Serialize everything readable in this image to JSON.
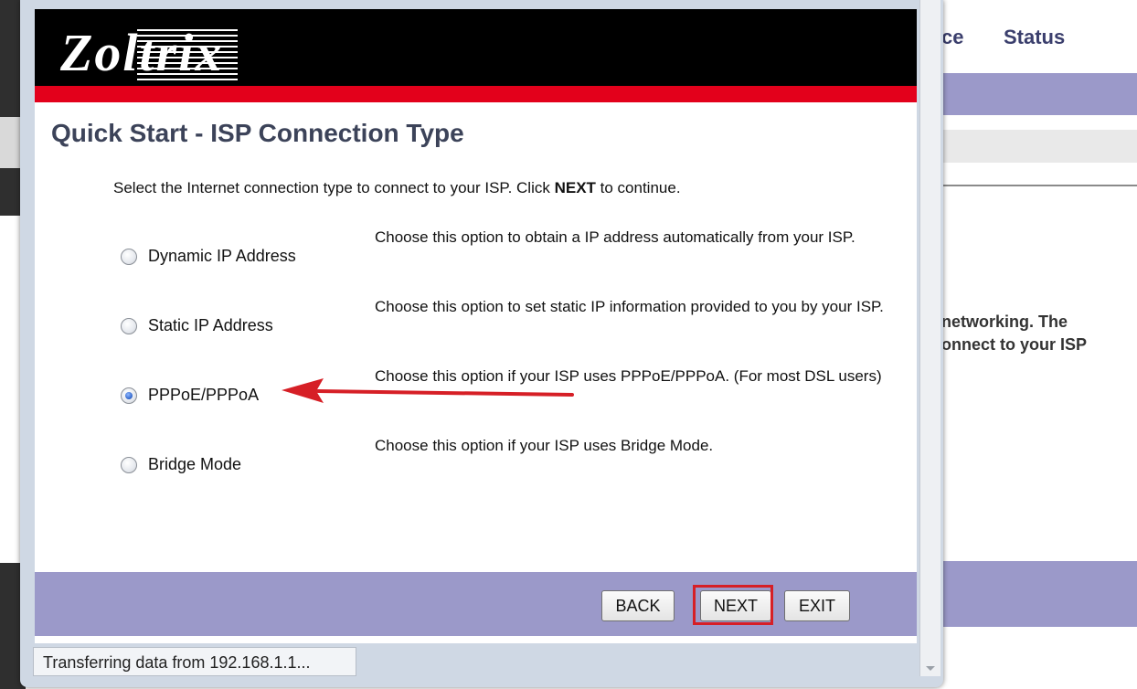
{
  "background": {
    "tab_partial": "ce",
    "tab_status": "Status",
    "body_text": "networking. The\nonnect to your ISP"
  },
  "popup": {
    "logo": "Zoltrix",
    "title": "Quick Start - ISP Connection Type",
    "instruction_prefix": "Select the Internet connection type to connect to your ISP. Click ",
    "instruction_bold": "NEXT",
    "instruction_suffix": " to continue.",
    "options": [
      {
        "label": "Dynamic IP Address",
        "description": "Choose this option to obtain a IP address automatically from your ISP.",
        "selected": false
      },
      {
        "label": "Static IP Address",
        "description": "Choose this option to set static IP information provided to you by your ISP.",
        "selected": false
      },
      {
        "label": "PPPoE/PPPoA",
        "description": "Choose this option if your ISP uses PPPoE/PPPoA. (For most DSL users)",
        "selected": true
      },
      {
        "label": "Bridge Mode",
        "description": "Choose this option if your ISP uses Bridge Mode.",
        "selected": false
      }
    ],
    "buttons": {
      "back": "BACK",
      "next": "NEXT",
      "exit": "EXIT"
    },
    "status_text": "Transferring data from 192.168.1.1..."
  },
  "colors": {
    "banner": "#000000",
    "banner_stripe": "#e3001b",
    "footer_bar": "#9b99c9",
    "annotation": "#d61f26"
  }
}
